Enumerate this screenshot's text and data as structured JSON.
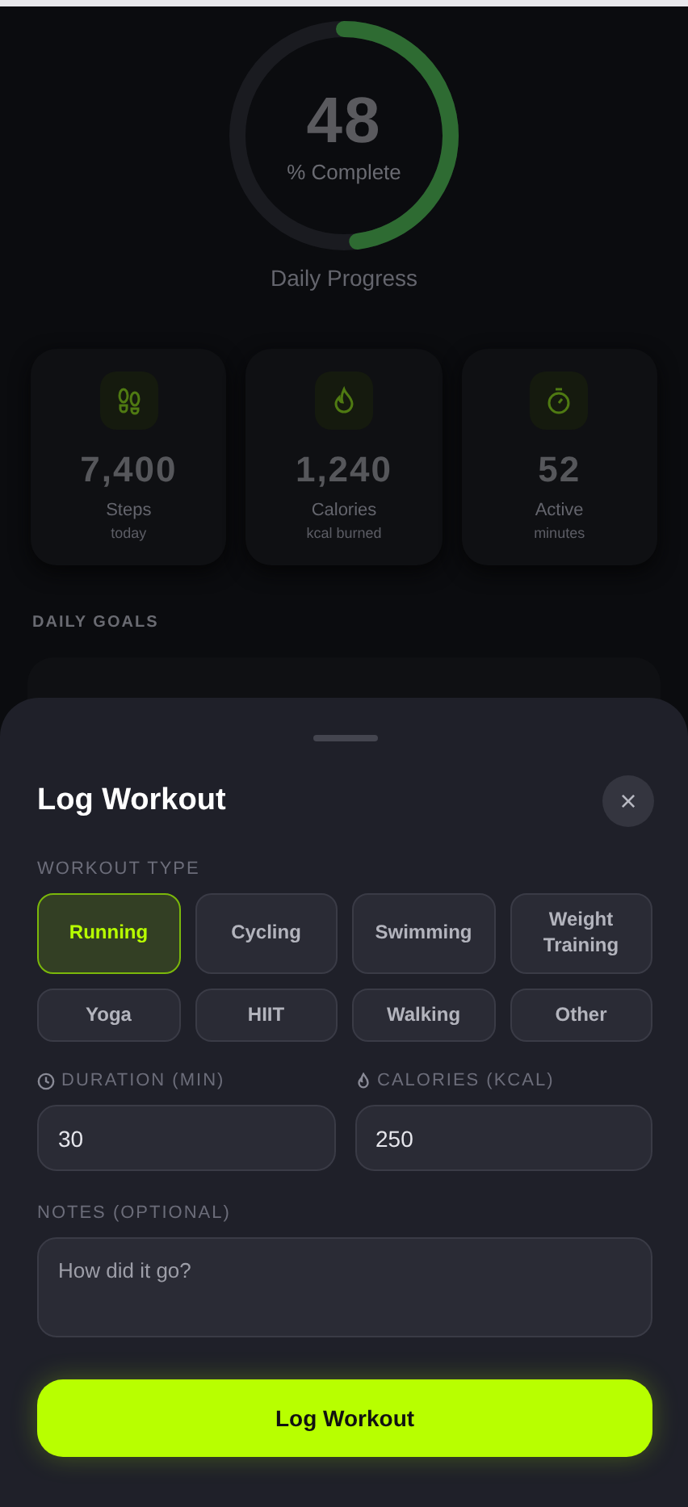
{
  "progress": {
    "value": "48",
    "caption": "% Complete",
    "level": 0.48,
    "title": "Daily Progress"
  },
  "stats": [
    {
      "kind": "steps",
      "value": "7,400",
      "label": "Steps",
      "sub": "today"
    },
    {
      "kind": "calories",
      "value": "1,240",
      "label": "Calories",
      "sub": "kcal burned"
    },
    {
      "kind": "active",
      "value": "52",
      "label": "Active",
      "sub": "minutes"
    }
  ],
  "goals": {
    "heading": "DAILY GOALS"
  },
  "sheet": {
    "title": "Log Workout",
    "close": "×",
    "type_label": "WORKOUT TYPE",
    "types": [
      {
        "label": "Running",
        "selected": true
      },
      {
        "label": "Cycling",
        "selected": false
      },
      {
        "label": "Swimming",
        "selected": false
      },
      {
        "label": "Weight Training",
        "selected": false
      },
      {
        "label": "Yoga",
        "selected": false
      },
      {
        "label": "HIIT",
        "selected": false
      },
      {
        "label": "Walking",
        "selected": false
      },
      {
        "label": "Other",
        "selected": false
      }
    ],
    "duration": {
      "label": "DURATION (MIN)",
      "value": "30"
    },
    "calories": {
      "label": "CALORIES (KCAL)",
      "value": "250"
    },
    "notes": {
      "label": "NOTES (OPTIONAL)",
      "placeholder": "How did it go?"
    },
    "submit": "Log Workout"
  }
}
